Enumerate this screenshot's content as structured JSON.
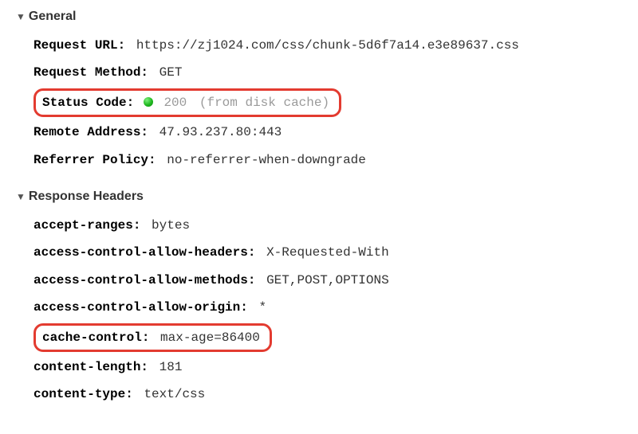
{
  "general": {
    "title": "General",
    "request_url_label": "Request URL:",
    "request_url_value": "https://zj1024.com/css/chunk-5d6f7a14.e3e89637.css",
    "request_method_label": "Request Method:",
    "request_method_value": "GET",
    "status_code_label": "Status Code:",
    "status_code_value": "200",
    "status_code_note": "(from disk cache)",
    "remote_address_label": "Remote Address:",
    "remote_address_value": "47.93.237.80:443",
    "referrer_policy_label": "Referrer Policy:",
    "referrer_policy_value": "no-referrer-when-downgrade"
  },
  "response_headers": {
    "title": "Response Headers",
    "accept_ranges_label": "accept-ranges:",
    "accept_ranges_value": "bytes",
    "ac_allow_headers_label": "access-control-allow-headers:",
    "ac_allow_headers_value": "X-Requested-With",
    "ac_allow_methods_label": "access-control-allow-methods:",
    "ac_allow_methods_value": "GET,POST,OPTIONS",
    "ac_allow_origin_label": "access-control-allow-origin:",
    "ac_allow_origin_value": "*",
    "cache_control_label": "cache-control:",
    "cache_control_value": "max-age=86400",
    "content_length_label": "content-length:",
    "content_length_value": "181",
    "content_type_label": "content-type:",
    "content_type_value": "text/css"
  }
}
